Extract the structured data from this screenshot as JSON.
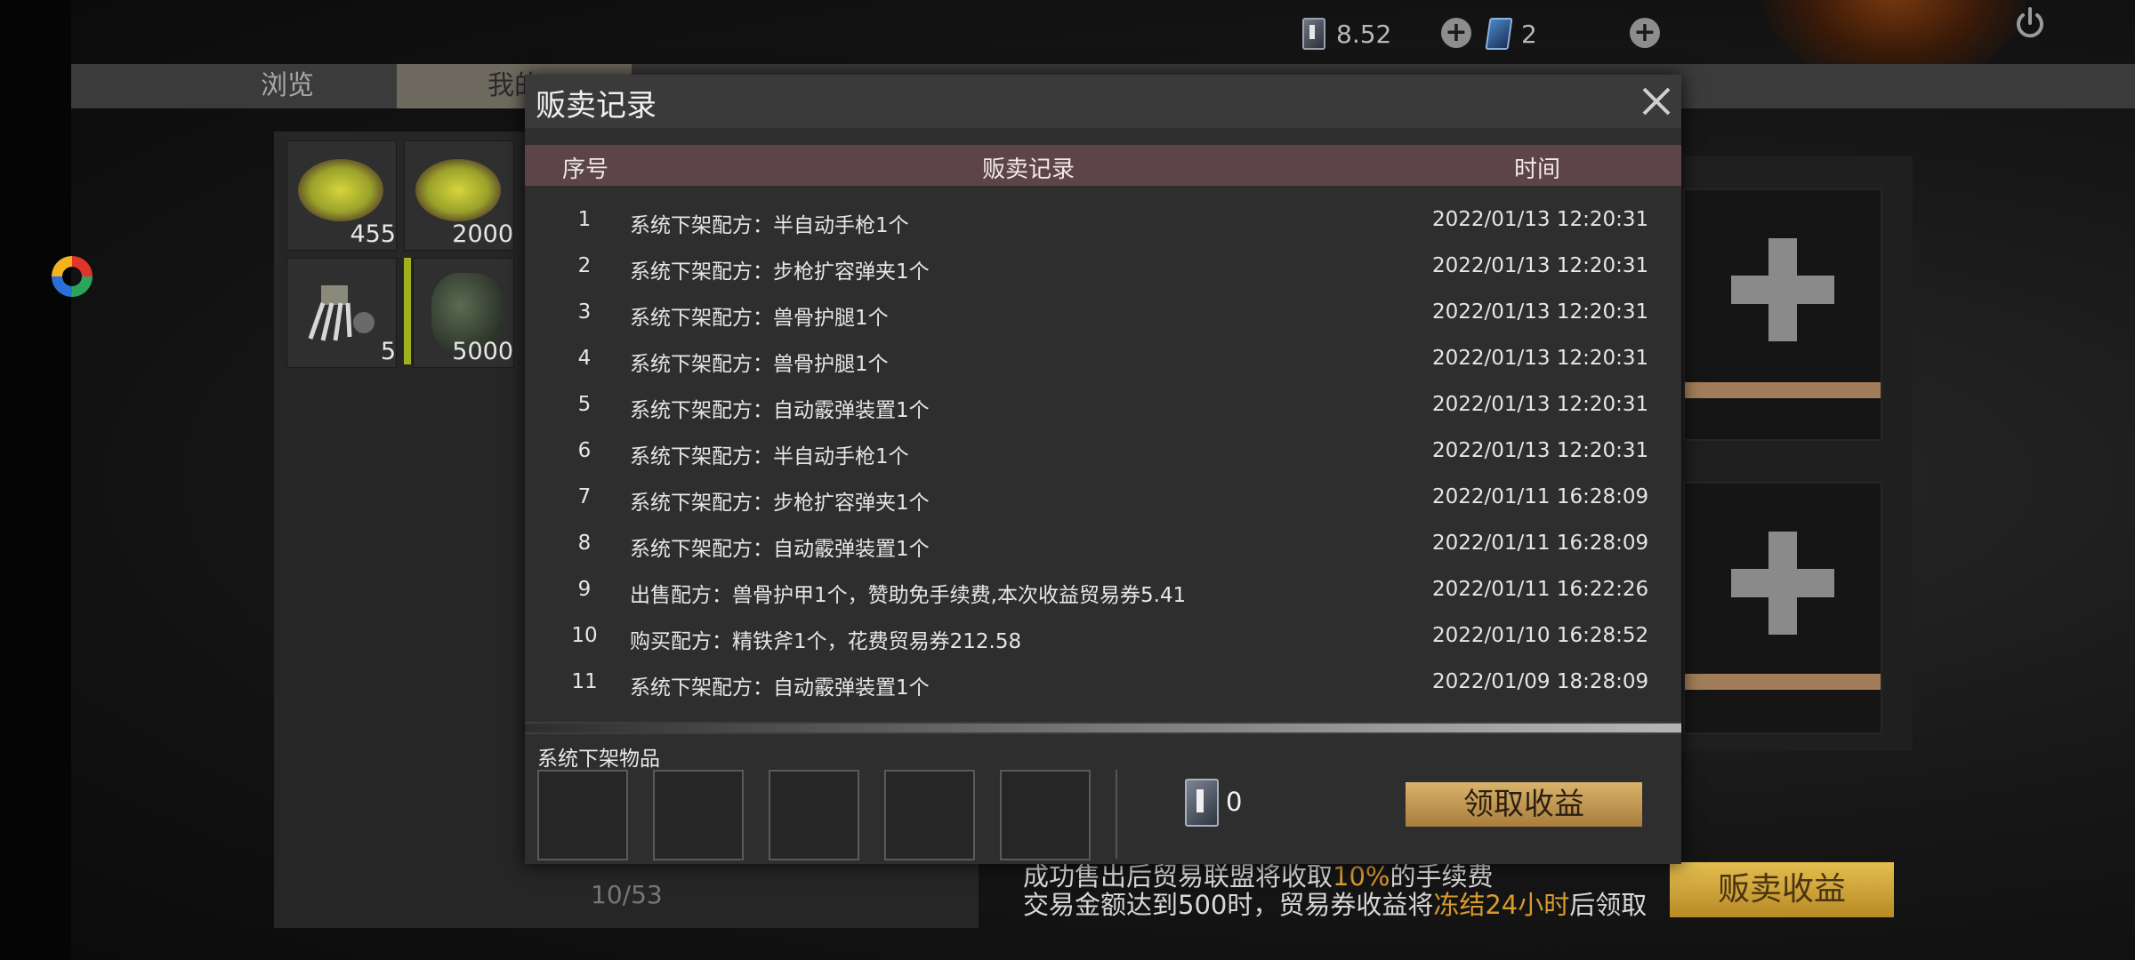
{
  "currency": {
    "tickets": "8.52",
    "gems": "2"
  },
  "tabs": {
    "browse": "浏览",
    "mine": "我的"
  },
  "inventory": {
    "items": [
      {
        "icon": "yellow-powder-icon",
        "count": "455"
      },
      {
        "icon": "yellow-powder-icon",
        "count": "2000"
      },
      {
        "icon": "spike-trap-icon",
        "count": "5"
      },
      {
        "icon": "cloth-bag-icon",
        "count": "5000"
      }
    ],
    "pager": "10/53"
  },
  "modal": {
    "title": "贩卖记录",
    "columns": {
      "index": "序号",
      "record": "贩卖记录",
      "time": "时间"
    },
    "rows": [
      {
        "index": "1",
        "record": "系统下架配方：半自动手枪1个",
        "time": "2022/01/13 12:20:31"
      },
      {
        "index": "2",
        "record": "系统下架配方：步枪扩容弹夹1个",
        "time": "2022/01/13 12:20:31"
      },
      {
        "index": "3",
        "record": "系统下架配方：兽骨护腿1个",
        "time": "2022/01/13 12:20:31"
      },
      {
        "index": "4",
        "record": "系统下架配方：兽骨护腿1个",
        "time": "2022/01/13 12:20:31"
      },
      {
        "index": "5",
        "record": "系统下架配方：自动霰弹装置1个",
        "time": "2022/01/13 12:20:31"
      },
      {
        "index": "6",
        "record": "系统下架配方：半自动手枪1个",
        "time": "2022/01/13 12:20:31"
      },
      {
        "index": "7",
        "record": "系统下架配方：步枪扩容弹夹1个",
        "time": "2022/01/11 16:28:09"
      },
      {
        "index": "8",
        "record": "系统下架配方：自动霰弹装置1个",
        "time": "2022/01/11 16:28:09"
      },
      {
        "index": "9",
        "record": "出售配方：兽骨护甲1个，赞助免手续费,本次收益贸易券5.41",
        "time": "2022/01/11 16:22:26"
      },
      {
        "index": "10",
        "record": "购买配方：精铁斧1个，花费贸易券212.58",
        "time": "2022/01/10 16:28:52"
      },
      {
        "index": "11",
        "record": "系统下架配方：自动霰弹装置1个",
        "time": "2022/01/09 18:28:09"
      }
    ],
    "system_label": "系统下架物品",
    "earnings_value": "0",
    "claim_button": "领取收益"
  },
  "bottom": {
    "note_line1_pre": "成功售出后贸易联盟将收取",
    "note_line1_hl": "10%",
    "note_line1_post": "的手续费",
    "note_line2_pre": "交易金额达到500时，贸易券收益将",
    "note_line2_hl": "冻结24小时",
    "note_line2_post": "后领取",
    "sell_button": "贩卖收益"
  },
  "colors": {
    "header_row": "#5c4448",
    "accent_gold": "#d89b2e",
    "claim_button": "#c49a52"
  }
}
